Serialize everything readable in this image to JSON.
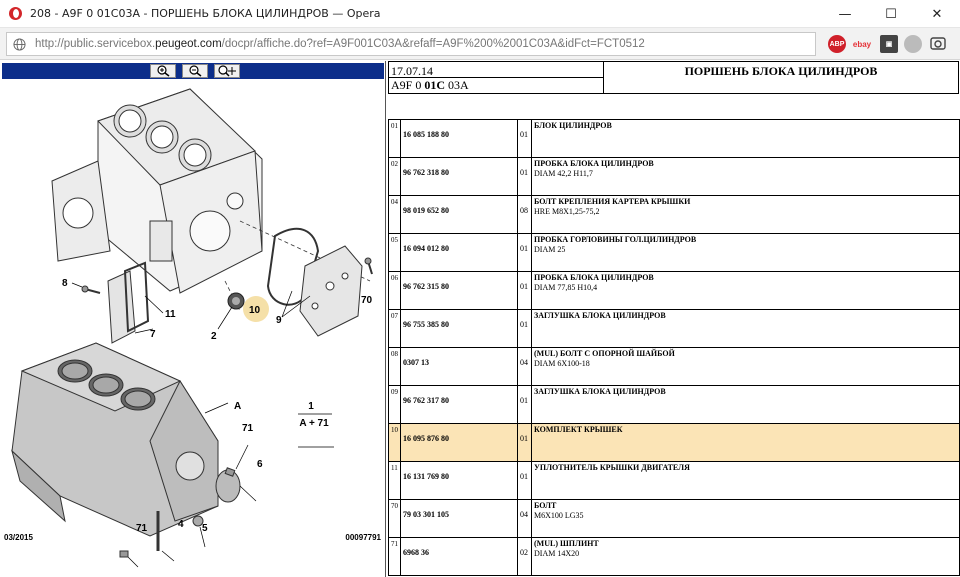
{
  "window": {
    "title": "208 - A9F 0 01C03A - ПОРШЕНЬ БЛОКА ЦИЛИНДРОВ — Opera",
    "minimize": "—",
    "maximize": "☐",
    "close": "✕"
  },
  "address": {
    "url_prefix": "http://public.servicebox.",
    "url_domain": "peugeot.com",
    "url_rest": "/docpr/affiche.do?ref=A9F001C03A&refaff=A9F%200%2001C03A&idFct=FCT0512"
  },
  "extensions": [
    {
      "name": "adblock-plus",
      "label": "ABP"
    },
    {
      "name": "ebay",
      "label": "ebay"
    },
    {
      "name": "extension",
      "label": "▣"
    },
    {
      "name": "gray-extension",
      "label": ""
    },
    {
      "name": "snapshot",
      "label": ""
    }
  ],
  "diagram": {
    "date": "03/2015",
    "code": "00097791",
    "callouts": [
      "8",
      "11",
      "7",
      "2",
      "10",
      "9",
      "70",
      "A",
      "71",
      "6",
      "71",
      "4",
      "5"
    ],
    "assembly": {
      "top": "1",
      "bottom": "A + 71"
    },
    "colors": {
      "highlight": "#f5e0a8",
      "line": "#333333",
      "toolbar": "#0c2e8a"
    }
  },
  "header": {
    "date": "17.07.14",
    "code_pre": "A9F 0 ",
    "code_bold": "01C",
    "code_post": " 03A",
    "title": "ПОРШЕНЬ БЛОКА ЦИЛИНДРОВ"
  },
  "parts": [
    {
      "num": "01",
      "ref": "16 085 188 80",
      "qty": "01",
      "name": "БЛОК ЦИЛИНДРОВ",
      "desc": "",
      "highlight": false
    },
    {
      "num": "02",
      "ref": "96 762 318 80",
      "qty": "01",
      "name": "ПРОБКА БЛОКА ЦИЛИНДРОВ",
      "desc": "DIAM 42,2 H11,7",
      "highlight": false
    },
    {
      "num": "04",
      "ref": "98 019 652 80",
      "qty": "08",
      "name": "БОЛТ КРЕПЛЕНИЯ КАРТЕРА КРЫШКИ",
      "desc": "HRE M8X1,25-75,2",
      "highlight": false
    },
    {
      "num": "05",
      "ref": "16 094 012 80",
      "qty": "01",
      "name": "ПРОБКА ГОРЛОВИНЫ ГОЛ.ЦИЛИНДРОВ",
      "desc": "DIAM 25",
      "highlight": false
    },
    {
      "num": "06",
      "ref": "96 762 315 80",
      "qty": "01",
      "name": "ПРОБКА БЛОКА ЦИЛИНДРОВ",
      "desc": "DIAM 77,85 H10,4",
      "highlight": false
    },
    {
      "num": "07",
      "ref": "96 755 385 80",
      "qty": "01",
      "name": "ЗАГЛУШКА БЛОКА ЦИЛИНДРОВ",
      "desc": "",
      "highlight": false
    },
    {
      "num": "08",
      "ref": "0307 13",
      "qty": "04",
      "name": "(MUL) БОЛТ С ОПОРНОЙ ШАЙБОЙ",
      "desc": "DIAM 6X100-18",
      "highlight": false
    },
    {
      "num": "09",
      "ref": "96 762 317 80",
      "qty": "01",
      "name": "ЗАГЛУШКА БЛОКА ЦИЛИНДРОВ",
      "desc": "",
      "highlight": false
    },
    {
      "num": "10",
      "ref": "16 095 876 80",
      "qty": "01",
      "name": "КОМПЛЕКТ КРЫШЕК",
      "desc": "",
      "highlight": true
    },
    {
      "num": "11",
      "ref": "16 131 769 80",
      "qty": "01",
      "name": "УПЛОТНИТЕЛЬ КРЫШКИ ДВИГАТЕЛЯ",
      "desc": "",
      "highlight": false
    },
    {
      "num": "70",
      "ref": "79 03 301 105",
      "qty": "04",
      "name": "БОЛТ",
      "desc": "M6X100 LG35",
      "highlight": false
    },
    {
      "num": "71",
      "ref": "6968 36",
      "qty": "02",
      "name": "(MUL) ШПЛИНТ",
      "desc": "DIAM 14X20",
      "highlight": false
    }
  ]
}
